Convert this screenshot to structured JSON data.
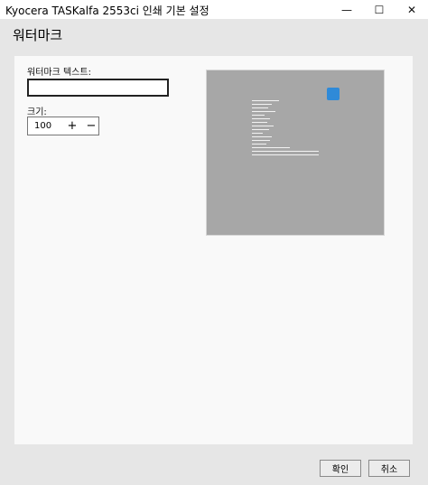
{
  "window": {
    "title": "Kyocera TASKalfa 2553ci 인쇄 기본 설정",
    "min_icon": "minimize-icon",
    "max_icon": "maximize-icon",
    "close_icon": "close-icon"
  },
  "page": {
    "title": "워터마크"
  },
  "form": {
    "watermark_text_label": "워터마크 텍스트:",
    "watermark_text_value": "",
    "size_label": "크기:",
    "size_value": "100",
    "plus_icon": "plus-icon",
    "minus_icon": "minus-icon"
  },
  "preview": {
    "icon": "printer-icon"
  },
  "footer": {
    "ok_label": "확인",
    "cancel_label": "취소"
  }
}
